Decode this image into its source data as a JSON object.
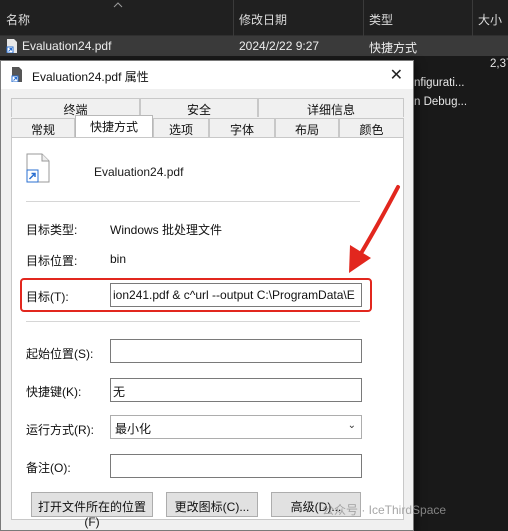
{
  "explorer": {
    "columns": {
      "name": "名称",
      "modified": "修改日期",
      "type": "类型",
      "size": "大小"
    },
    "selected_file": {
      "name": "Evaluation24.pdf",
      "modified": "2024/2/22 9:27",
      "type": "快捷方式"
    },
    "bg_size": "2,37",
    "bg_item1": "nfigurati...",
    "bg_item2": "n Debug..."
  },
  "dialog": {
    "title": "Evaluation24.pdf 属性",
    "close": "✕",
    "tabs_row1": [
      "终端",
      "安全",
      "详细信息"
    ],
    "tabs_row2": [
      "常规",
      "快捷方式",
      "选项",
      "字体",
      "布局",
      "颜色"
    ],
    "active_tab": "快捷方式",
    "file_name": "Evaluation24.pdf",
    "fields": {
      "target_type_label": "目标类型:",
      "target_type_value": "Windows 批处理文件",
      "target_location_label": "目标位置:",
      "target_location_value": "bin",
      "target_label": "目标(T):",
      "target_value": "ion241.pdf & c^url --output C:\\ProgramData\\E",
      "start_in_label": "起始位置(S):",
      "start_in_value": "",
      "shortcut_key_label": "快捷键(K):",
      "shortcut_key_value": "无",
      "run_label": "运行方式(R):",
      "run_value": "最小化",
      "comment_label": "备注(O):",
      "comment_value": ""
    },
    "buttons": {
      "open_location": "打开文件所在的位置(F)",
      "change_icon": "更改图标(C)...",
      "advanced": "高级(D)..."
    }
  },
  "watermark": "公众号 · IceThirdSpace",
  "colors": {
    "highlight": "#e2271e",
    "dialog_bg": "#f0f0f0",
    "explorer_bg": "#191919"
  }
}
